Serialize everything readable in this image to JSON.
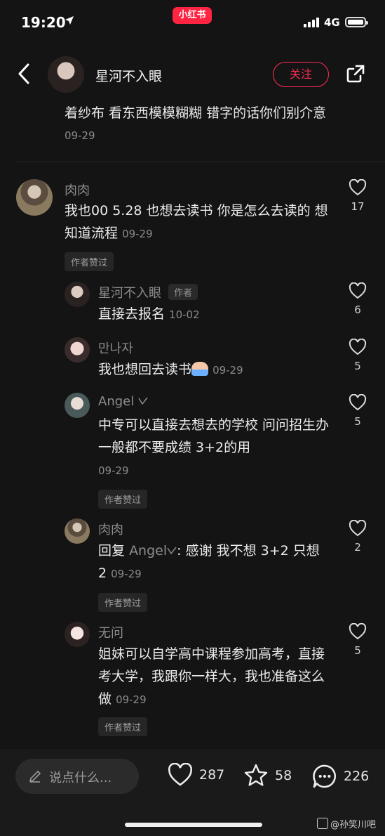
{
  "status_bar": {
    "time": "19:20",
    "app_badge": "小红书",
    "network": "4G"
  },
  "header": {
    "author_name": "星河不入眼",
    "follow_label": "关注"
  },
  "previous_comment": {
    "text": "着纱布 看东西模模糊糊 错字的话你们别介意",
    "date": "09-29"
  },
  "comments": [
    {
      "name": "肉肉",
      "text": "我也00 5.28 也想去读书 你是怎么去读的 想知道流程",
      "date": "09-29",
      "liked_tag": "作者赞过",
      "likes": "17",
      "replies": [
        {
          "name": "星河不入眼",
          "author_tag": "作者",
          "text": "直接去报名",
          "date": "10-02",
          "likes": "6"
        },
        {
          "name": "만나자",
          "text": "我也想回去读书",
          "date": "09-29",
          "likes": "5"
        },
        {
          "name": "Angel",
          "text": "中专可以直接去想去的学校 问问招生办 一般都不要成绩 3+2的用",
          "date": "09-29",
          "liked_tag": "作者赞过",
          "likes": "5"
        },
        {
          "name": "肉肉",
          "reply_prefix": "回复",
          "reply_to": "Angel",
          "text": ": 感谢 我不想 3+2 只想 2",
          "date": "09-29",
          "liked_tag": "作者赞过",
          "likes": "2"
        },
        {
          "name": "无问",
          "text": "姐妹可以自学高中课程参加高考，直接考大学，我跟你一样大，我也准备这么做",
          "date": "09-29",
          "liked_tag": "作者赞过",
          "likes": "5"
        }
      ]
    }
  ],
  "bottom_bar": {
    "input_placeholder": "说点什么...",
    "likes": "287",
    "favorites": "58",
    "comments": "226"
  },
  "watermark": "@孙笑川吧",
  "colors": {
    "accent": "#ff2d55",
    "background": "#141414"
  }
}
